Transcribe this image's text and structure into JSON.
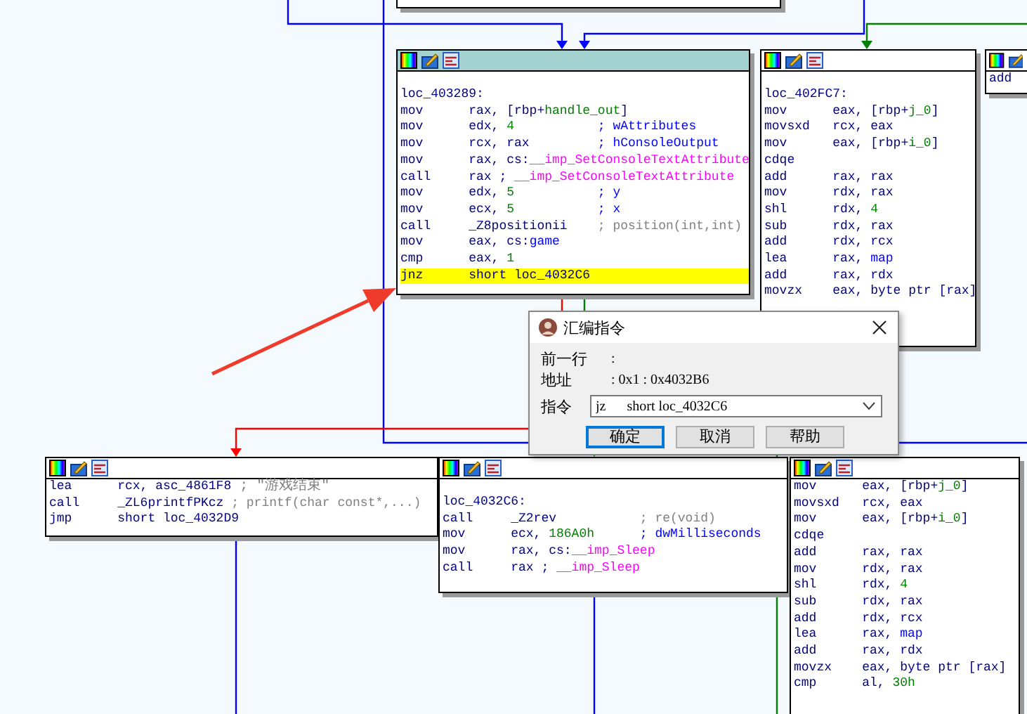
{
  "blocks": [
    {
      "selected": true,
      "label": "loc_403289:",
      "lines": [
        {
          "mnemonic": "mov",
          "operands": [
            {
              "text": "rax, [rbp+",
              "kind": "plain"
            },
            {
              "text": "handle_out",
              "kind": "var"
            },
            {
              "text": "]",
              "kind": "plain"
            }
          ],
          "highlighted": false
        },
        {
          "mnemonic": "mov",
          "operands": [
            {
              "text": "edx, ",
              "kind": "plain"
            },
            {
              "text": "4",
              "kind": "number"
            }
          ],
          "comment": {
            "text": "; wAttributes",
            "kind": "comment"
          },
          "highlighted": false
        },
        {
          "mnemonic": "mov",
          "operands": [
            {
              "text": "rcx, rax",
              "kind": "plain"
            }
          ],
          "comment": {
            "text": "; hConsoleOutput",
            "kind": "comment"
          },
          "highlighted": false
        },
        {
          "mnemonic": "mov",
          "operands": [
            {
              "text": "rax, cs:",
              "kind": "plain"
            },
            {
              "text": "__imp_SetConsoleTextAttribute",
              "kind": "import"
            }
          ],
          "highlighted": false
        },
        {
          "mnemonic": "call",
          "operands": [
            {
              "text": "rax ; ",
              "kind": "plain"
            },
            {
              "text": "__imp_SetConsoleTextAttribute",
              "kind": "import"
            }
          ],
          "highlighted": false
        },
        {
          "mnemonic": "mov",
          "operands": [
            {
              "text": "edx, ",
              "kind": "plain"
            },
            {
              "text": "5",
              "kind": "number"
            }
          ],
          "comment": {
            "text": "; y",
            "kind": "comment"
          },
          "highlighted": false
        },
        {
          "mnemonic": "mov",
          "operands": [
            {
              "text": "ecx, ",
              "kind": "plain"
            },
            {
              "text": "5",
              "kind": "number"
            }
          ],
          "comment": {
            "text": "; x",
            "kind": "comment"
          },
          "highlighted": false
        },
        {
          "mnemonic": "call",
          "operands": [
            {
              "text": "_Z8positionii",
              "kind": "plain"
            }
          ],
          "comment": {
            "text": "; position(int,int)",
            "kind": "auto"
          },
          "highlighted": false
        },
        {
          "mnemonic": "mov",
          "operands": [
            {
              "text": "eax, cs:",
              "kind": "plain"
            },
            {
              "text": "game",
              "kind": "name"
            }
          ],
          "highlighted": false
        },
        {
          "mnemonic": "cmp",
          "operands": [
            {
              "text": "eax, ",
              "kind": "plain"
            },
            {
              "text": "1",
              "kind": "number"
            }
          ],
          "highlighted": false
        },
        {
          "mnemonic": "jnz",
          "operands": [
            {
              "text": "short loc_4032C6",
              "kind": "plain"
            }
          ],
          "highlighted": true
        }
      ]
    },
    {
      "selected": false,
      "label": "loc_402FC7:",
      "lines": [
        {
          "mnemonic": "mov",
          "operands": [
            {
              "text": "eax, [rbp+",
              "kind": "plain"
            },
            {
              "text": "j_0",
              "kind": "var"
            },
            {
              "text": "]",
              "kind": "plain"
            }
          ],
          "highlighted": false
        },
        {
          "mnemonic": "movsxd",
          "operands": [
            {
              "text": "rcx, eax",
              "kind": "plain"
            }
          ],
          "highlighted": false
        },
        {
          "mnemonic": "mov",
          "operands": [
            {
              "text": "eax, [rbp+",
              "kind": "plain"
            },
            {
              "text": "i_0",
              "kind": "var"
            },
            {
              "text": "]",
              "kind": "plain"
            }
          ],
          "highlighted": false
        },
        {
          "mnemonic": "cdqe",
          "highlighted": false
        },
        {
          "mnemonic": "add",
          "operands": [
            {
              "text": "rax, rax",
              "kind": "plain"
            }
          ],
          "highlighted": false
        },
        {
          "mnemonic": "mov",
          "operands": [
            {
              "text": "rdx, rax",
              "kind": "plain"
            }
          ],
          "highlighted": false
        },
        {
          "mnemonic": "shl",
          "operands": [
            {
              "text": "rdx, ",
              "kind": "plain"
            },
            {
              "text": "4",
              "kind": "number"
            }
          ],
          "highlighted": false
        },
        {
          "mnemonic": "sub",
          "operands": [
            {
              "text": "rdx, rax",
              "kind": "plain"
            }
          ],
          "highlighted": false
        },
        {
          "mnemonic": "add",
          "operands": [
            {
              "text": "rdx, rcx",
              "kind": "plain"
            }
          ],
          "highlighted": false
        },
        {
          "mnemonic": "lea",
          "operands": [
            {
              "text": "rax, ",
              "kind": "plain"
            },
            {
              "text": "map",
              "kind": "name"
            }
          ],
          "highlighted": false
        },
        {
          "mnemonic": "add",
          "operands": [
            {
              "text": "rax, rdx",
              "kind": "plain"
            }
          ],
          "highlighted": false
        },
        {
          "mnemonic": "movzx",
          "operands": [
            {
              "text": "eax, byte ptr [rax]",
              "kind": "plain"
            }
          ],
          "highlighted": false
        }
      ]
    },
    {
      "selected": false,
      "lines": [
        {
          "mnemonic": "add",
          "highlighted": false
        }
      ]
    },
    {
      "selected": false,
      "lines": [
        {
          "mnemonic": "lea",
          "operands": [
            {
              "text": "rcx, asc_4861F8",
              "kind": "plain"
            }
          ],
          "comment": {
            "text": "; \"游戏结束\"",
            "kind": "auto"
          },
          "highlighted": false
        },
        {
          "mnemonic": "call",
          "operands": [
            {
              "text": "_ZL6printfPKcz",
              "kind": "plain"
            }
          ],
          "comment": {
            "text": "; printf(char const*,...)",
            "kind": "auto"
          },
          "highlighted": false
        },
        {
          "mnemonic": "jmp",
          "operands": [
            {
              "text": "short loc_4032D9",
              "kind": "plain"
            }
          ],
          "highlighted": false
        }
      ]
    },
    {
      "selected": false,
      "label": "loc_4032C6:",
      "lines": [
        {
          "mnemonic": "call",
          "operands": [
            {
              "text": "_Z2rev",
              "kind": "plain"
            }
          ],
          "comment": {
            "text": "; re(void)",
            "kind": "auto"
          },
          "highlighted": false
        },
        {
          "mnemonic": "mov",
          "operands": [
            {
              "text": "ecx, ",
              "kind": "plain"
            },
            {
              "text": "186A0h",
              "kind": "number"
            }
          ],
          "comment": {
            "text": "; dwMilliseconds",
            "kind": "comment"
          },
          "highlighted": false
        },
        {
          "mnemonic": "mov",
          "operands": [
            {
              "text": "rax, cs:",
              "kind": "plain"
            },
            {
              "text": "__imp_Sleep",
              "kind": "import"
            }
          ],
          "highlighted": false
        },
        {
          "mnemonic": "call",
          "operands": [
            {
              "text": "rax ; ",
              "kind": "plain"
            },
            {
              "text": "__imp_Sleep",
              "kind": "import"
            }
          ],
          "highlighted": false
        }
      ]
    },
    {
      "selected": false,
      "lines": [
        {
          "mnemonic": "mov",
          "operands": [
            {
              "text": "eax, [rbp+",
              "kind": "plain"
            },
            {
              "text": "j_0",
              "kind": "var"
            },
            {
              "text": "]",
              "kind": "plain"
            }
          ],
          "highlighted": false
        },
        {
          "mnemonic": "movsxd",
          "operands": [
            {
              "text": "rcx, eax",
              "kind": "plain"
            }
          ],
          "highlighted": false
        },
        {
          "mnemonic": "mov",
          "operands": [
            {
              "text": "eax, [rbp+",
              "kind": "plain"
            },
            {
              "text": "i_0",
              "kind": "var"
            },
            {
              "text": "]",
              "kind": "plain"
            }
          ],
          "highlighted": false
        },
        {
          "mnemonic": "cdqe",
          "highlighted": false
        },
        {
          "mnemonic": "add",
          "operands": [
            {
              "text": "rax, rax",
              "kind": "plain"
            }
          ],
          "highlighted": false
        },
        {
          "mnemonic": "mov",
          "operands": [
            {
              "text": "rdx, rax",
              "kind": "plain"
            }
          ],
          "highlighted": false
        },
        {
          "mnemonic": "shl",
          "operands": [
            {
              "text": "rdx, ",
              "kind": "plain"
            },
            {
              "text": "4",
              "kind": "number"
            }
          ],
          "highlighted": false
        },
        {
          "mnemonic": "sub",
          "operands": [
            {
              "text": "rdx, rax",
              "kind": "plain"
            }
          ],
          "highlighted": false
        },
        {
          "mnemonic": "add",
          "operands": [
            {
              "text": "rdx, rcx",
              "kind": "plain"
            }
          ],
          "highlighted": false
        },
        {
          "mnemonic": "lea",
          "operands": [
            {
              "text": "rax, ",
              "kind": "plain"
            },
            {
              "text": "map",
              "kind": "name"
            }
          ],
          "highlighted": false
        },
        {
          "mnemonic": "add",
          "operands": [
            {
              "text": "rax, rdx",
              "kind": "plain"
            }
          ],
          "highlighted": false
        },
        {
          "mnemonic": "movzx",
          "operands": [
            {
              "text": "eax, byte ptr [rax]",
              "kind": "plain"
            }
          ],
          "highlighted": false
        },
        {
          "mnemonic": "cmp",
          "operands": [
            {
              "text": "al, ",
              "kind": "plain"
            },
            {
              "text": "30h",
              "kind": "number"
            }
          ],
          "highlighted": false
        }
      ]
    }
  ],
  "dialog": {
    "title": "汇编指令",
    "rows": [
      {
        "label": "前一行",
        "value": ":"
      },
      {
        "label": "地址",
        "value": ": 0x1 : 0x4032B6"
      }
    ],
    "instruction": {
      "label": "指令",
      "value": "jz      short loc_4032C6"
    },
    "buttons": [
      {
        "label": "确定",
        "focused": true
      },
      {
        "label": "取消",
        "focused": false
      },
      {
        "label": "帮助",
        "focused": false
      }
    ]
  }
}
